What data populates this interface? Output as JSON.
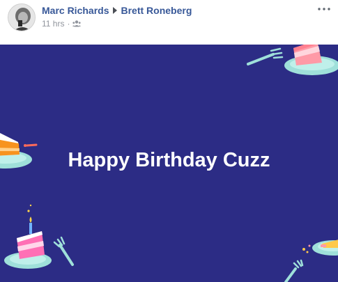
{
  "post": {
    "author": "Marc Richards",
    "recipient": "Brett Roneberg",
    "timestamp": "11 hrs",
    "separator": "·",
    "audience_icon": "friends-icon",
    "more_icon": "more-options-icon"
  },
  "card": {
    "message": "Happy Birthday Cuzz",
    "background_color": "#2c2c85"
  },
  "colors": {
    "name_link": "#385898",
    "meta_text": "#90949c"
  }
}
